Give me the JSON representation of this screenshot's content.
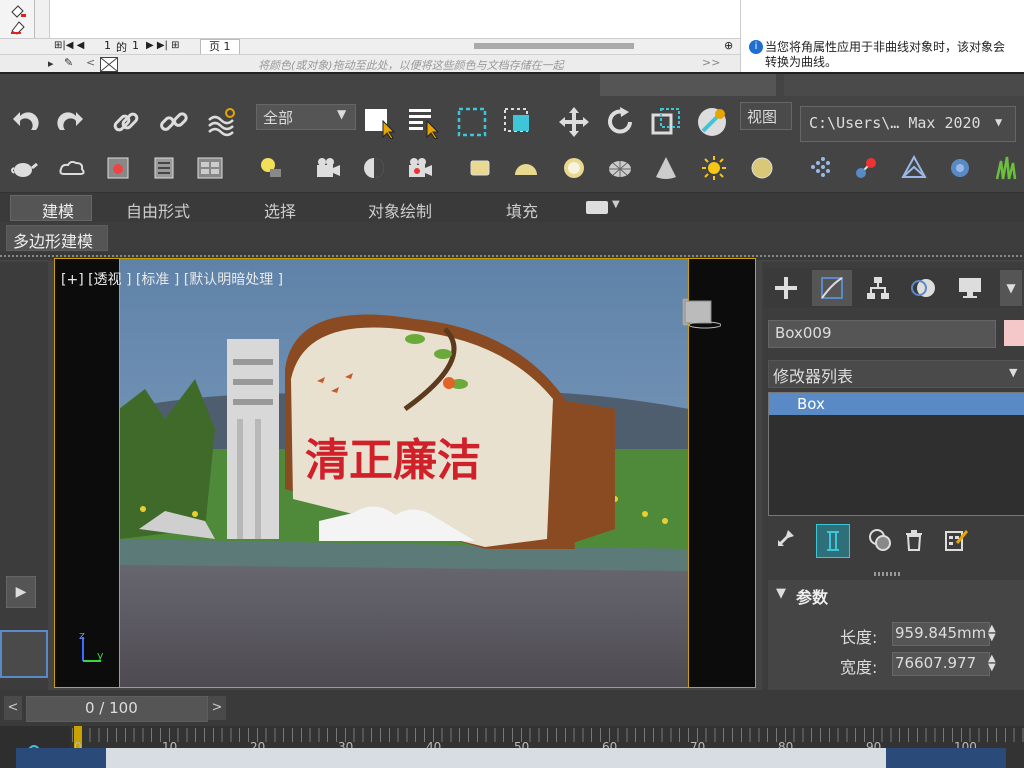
{
  "corel": {
    "page_nav": {
      "page_current": "1",
      "of_label": "的",
      "page_total": "1",
      "page_tab": "页 1"
    },
    "color_hint": "将颜色(或对象)拖动至此处，以便将这些颜色与文档存储在一起",
    "notice_text": "当您将角属性应用于非曲线对象时，该对象会转换为曲线。"
  },
  "toolbar": {
    "selection_filter": "全部",
    "view_label": "视图",
    "path_dropdown": "C:\\Users\\… Max 2020"
  },
  "ribbon": {
    "tabs": [
      "建模",
      "自由形式",
      "选择",
      "对象绘制",
      "填充"
    ],
    "subtab": "多边形建模"
  },
  "viewport": {
    "label": "[+] [透视 ] [标准 ] [默认明暗处理 ]",
    "sign_text": "清正廉洁",
    "axis_z": "z",
    "axis_y": "y"
  },
  "command_panel": {
    "object_name": "Box009",
    "modifier_list_label": "修改器列表",
    "modifier_item": "Box",
    "rollout_title": "参数",
    "params": [
      {
        "label": "长度:",
        "value": "959.845mm"
      },
      {
        "label": "宽度:",
        "value": "76607.977"
      }
    ]
  },
  "timeline": {
    "frame_display": "0 / 100",
    "ticks": [
      "0",
      "10",
      "20",
      "30",
      "40",
      "50",
      "60",
      "70",
      "80",
      "90",
      "100"
    ]
  },
  "colors": {
    "ui_bg": "#444444",
    "accent_blue": "#5a8ac6",
    "viewport_border": "#c9a200",
    "cyan_icon": "#3ec5d8"
  }
}
